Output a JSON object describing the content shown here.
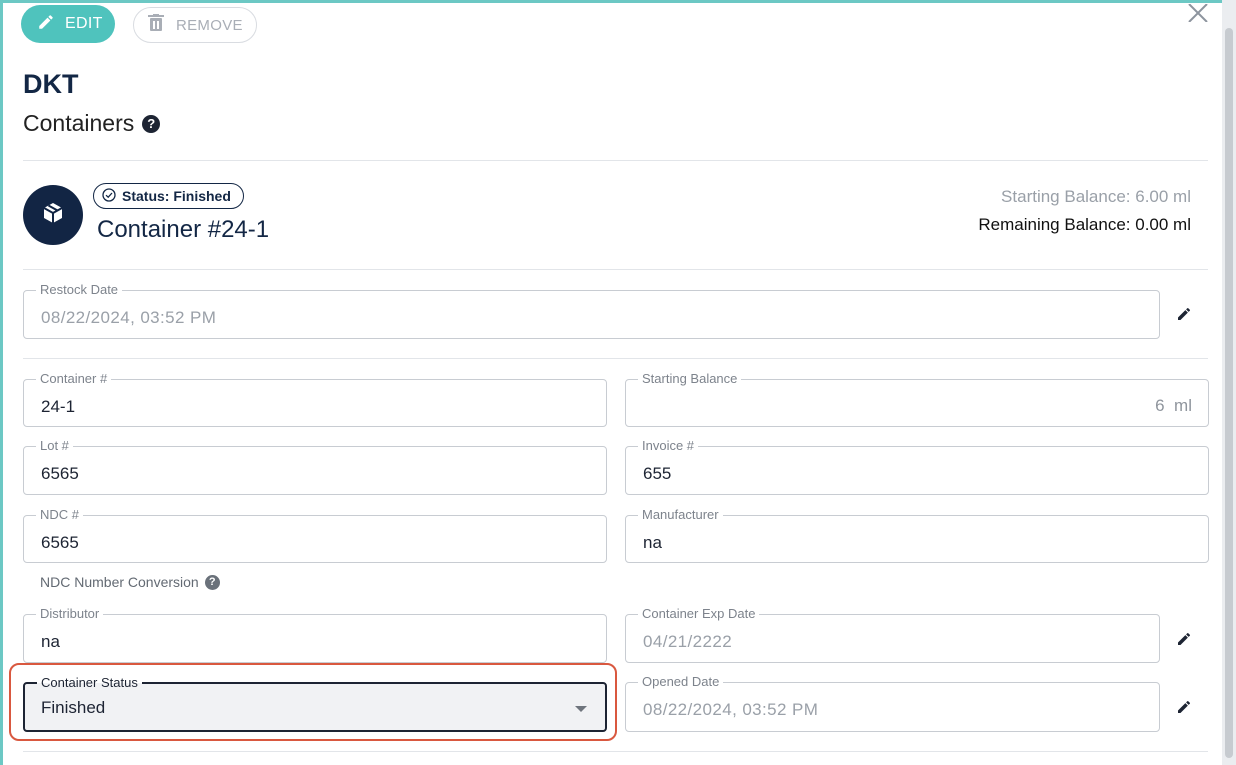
{
  "toolbar": {
    "edit_label": "EDIT",
    "remove_label": "REMOVE"
  },
  "header": {
    "title": "DKT",
    "subtitle": "Containers"
  },
  "container": {
    "status": "Status: Finished",
    "name": "Container #24-1",
    "starting_balance": "Starting Balance: 6.00 ml",
    "remaining_balance": "Remaining Balance: 0.00 ml"
  },
  "fields": {
    "restock_date": {
      "label": "Restock Date",
      "value": "08/22/2024, 03:52 PM"
    },
    "container_num": {
      "label": "Container #",
      "value": "24-1"
    },
    "starting_balance": {
      "label": "Starting Balance",
      "value": "6",
      "unit": "ml"
    },
    "lot_num": {
      "label": "Lot #",
      "value": "6565"
    },
    "invoice_num": {
      "label": "Invoice #",
      "value": "655"
    },
    "ndc_num": {
      "label": "NDC #",
      "value": "6565"
    },
    "manufacturer": {
      "label": "Manufacturer",
      "value": "na"
    },
    "ndc_conversion": {
      "label": "NDC Number Conversion"
    },
    "distributor": {
      "label": "Distributor",
      "value": "na"
    },
    "container_exp": {
      "label": "Container Exp Date",
      "value": "04/21/2222"
    },
    "container_status": {
      "label": "Container Status",
      "value": "Finished"
    },
    "opened_date": {
      "label": "Opened Date",
      "value": "08/22/2024, 03:52 PM"
    }
  },
  "colors": {
    "accent": "#4fc3bd",
    "navy": "#132745",
    "highlight": "#d9583f"
  }
}
